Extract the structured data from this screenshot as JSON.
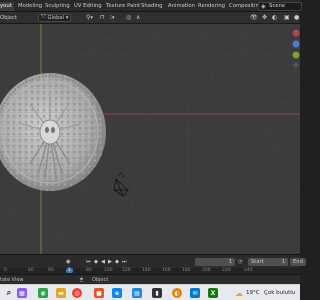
{
  "tabs": [
    {
      "label": "yout",
      "active": true
    },
    {
      "label": "Modeling",
      "active": false
    },
    {
      "label": "Sculpting",
      "active": false
    },
    {
      "label": "UV Editing",
      "active": false
    },
    {
      "label": "Texture Paint",
      "active": false
    },
    {
      "label": "Shading",
      "active": false
    },
    {
      "label": "Animation",
      "active": false
    },
    {
      "label": "Rendering",
      "active": false
    },
    {
      "label": "Compositin",
      "active": false
    }
  ],
  "scene": {
    "label": "Scene"
  },
  "header": {
    "mode": "Object",
    "transform_orientation": "Global"
  },
  "timeline": {
    "current_frame": "1",
    "start_label": "Start",
    "start_value": "1",
    "end_label": "End"
  },
  "ticks": [
    "0",
    "40",
    "60",
    "80",
    "100",
    "120",
    "140",
    "160",
    "180",
    "200",
    "220",
    "240"
  ],
  "status": {
    "left": "tate View",
    "right": "Object"
  },
  "taskbar": {
    "weather_temp": "19°C",
    "weather_text": "Çok bulutlu"
  },
  "colors": {
    "viewport_bg": "#3c3c3c",
    "x_axis": "#b0454f",
    "y_axis": "#7ea032",
    "active_frame": "#4772b3"
  }
}
